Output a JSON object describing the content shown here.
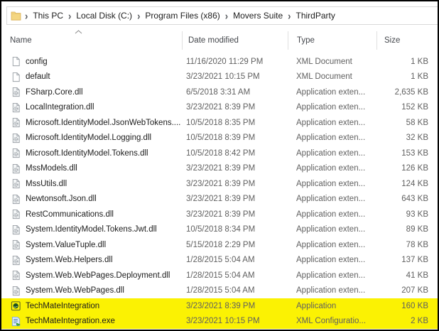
{
  "breadcrumb": {
    "separator": "›",
    "items": [
      "This PC",
      "Local Disk (C:)",
      "Program Files (x86)",
      "Movers Suite",
      "ThirdParty"
    ]
  },
  "columns": {
    "name": "Name",
    "date": "Date modified",
    "type": "Type",
    "size": "Size"
  },
  "colors": {
    "highlight": "#fbf203",
    "folder": "#f4d682"
  },
  "files": [
    {
      "name": "config",
      "date": "11/16/2020 11:29 PM",
      "type": "XML Document",
      "size": "1 KB",
      "icon": "xml-document",
      "highlight": false
    },
    {
      "name": "default",
      "date": "3/23/2021 10:15 PM",
      "type": "XML Document",
      "size": "1 KB",
      "icon": "xml-document",
      "highlight": false
    },
    {
      "name": "FSharp.Core.dll",
      "date": "6/5/2018 3:31 AM",
      "type": "Application exten...",
      "size": "2,635 KB",
      "icon": "dll",
      "highlight": false
    },
    {
      "name": "LocalIntegration.dll",
      "date": "3/23/2021 8:39 PM",
      "type": "Application exten...",
      "size": "152 KB",
      "icon": "dll",
      "highlight": false
    },
    {
      "name": "Microsoft.IdentityModel.JsonWebTokens....",
      "date": "10/5/2018 8:35 PM",
      "type": "Application exten...",
      "size": "58 KB",
      "icon": "dll",
      "highlight": false
    },
    {
      "name": "Microsoft.IdentityModel.Logging.dll",
      "date": "10/5/2018 8:39 PM",
      "type": "Application exten...",
      "size": "32 KB",
      "icon": "dll",
      "highlight": false
    },
    {
      "name": "Microsoft.IdentityModel.Tokens.dll",
      "date": "10/5/2018 8:42 PM",
      "type": "Application exten...",
      "size": "153 KB",
      "icon": "dll",
      "highlight": false
    },
    {
      "name": "MssModels.dll",
      "date": "3/23/2021 8:39 PM",
      "type": "Application exten...",
      "size": "126 KB",
      "icon": "dll",
      "highlight": false
    },
    {
      "name": "MssUtils.dll",
      "date": "3/23/2021 8:39 PM",
      "type": "Application exten...",
      "size": "124 KB",
      "icon": "dll",
      "highlight": false
    },
    {
      "name": "Newtonsoft.Json.dll",
      "date": "3/23/2021 8:39 PM",
      "type": "Application exten...",
      "size": "643 KB",
      "icon": "dll",
      "highlight": false
    },
    {
      "name": "RestCommunications.dll",
      "date": "3/23/2021 8:39 PM",
      "type": "Application exten...",
      "size": "93 KB",
      "icon": "dll",
      "highlight": false
    },
    {
      "name": "System.IdentityModel.Tokens.Jwt.dll",
      "date": "10/5/2018 8:34 PM",
      "type": "Application exten...",
      "size": "89 KB",
      "icon": "dll",
      "highlight": false
    },
    {
      "name": "System.ValueTuple.dll",
      "date": "5/15/2018 2:29 PM",
      "type": "Application exten...",
      "size": "78 KB",
      "icon": "dll",
      "highlight": false
    },
    {
      "name": "System.Web.Helpers.dll",
      "date": "1/28/2015 5:04 AM",
      "type": "Application exten...",
      "size": "137 KB",
      "icon": "dll",
      "highlight": false
    },
    {
      "name": "System.Web.WebPages.Deployment.dll",
      "date": "1/28/2015 5:04 AM",
      "type": "Application exten...",
      "size": "41 KB",
      "icon": "dll",
      "highlight": false
    },
    {
      "name": "System.Web.WebPages.dll",
      "date": "1/28/2015 5:04 AM",
      "type": "Application exten...",
      "size": "207 KB",
      "icon": "dll",
      "highlight": false
    },
    {
      "name": "TechMateIntegration",
      "date": "3/23/2021 8:39 PM",
      "type": "Application",
      "size": "160 KB",
      "icon": "application",
      "highlight": true
    },
    {
      "name": "TechMateIntegration.exe",
      "date": "3/23/2021 10:15 PM",
      "type": "XML Configuratio...",
      "size": "2 KB",
      "icon": "exe-config",
      "highlight": true
    }
  ]
}
